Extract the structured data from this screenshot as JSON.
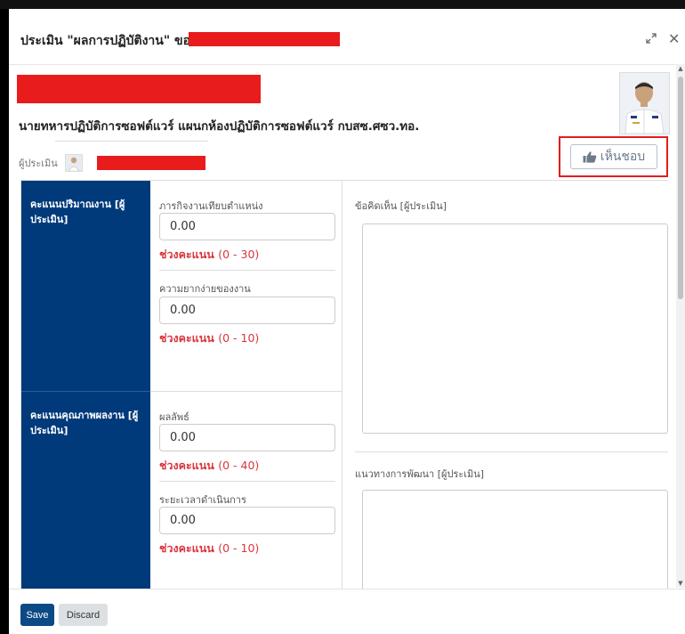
{
  "dialog": {
    "title_prefix": "ประเมิน \"ผลการปฏิบัติงาน\" ของ",
    "expand_icon": "expand-icon",
    "close_icon": "close-icon",
    "close_glyph": "✕"
  },
  "employee": {
    "position": "นายทหารปฏิบัติการซอฟต์แวร์ แผนกห้องปฏิบัติการซอฟต์แวร์ กบสซ.ศซว.ทอ.",
    "evaluator_label": "ผู้ประเมิน"
  },
  "like_button": {
    "label": "เห็นชอบ",
    "icon": "thumbs-up-icon"
  },
  "sections": [
    {
      "label": "คะแนนปริมาณงาน [ผู้ประเมิน]",
      "fields": [
        {
          "label": "ภารกิจงานเทียบตำแหน่ง",
          "value": "0.00",
          "range_label": "ช่วงคะแนน",
          "range": "(0 - 30)"
        },
        {
          "label": "ความยากง่ายของงาน",
          "value": "0.00",
          "range_label": "ช่วงคะแนน",
          "range": "(0 - 10)"
        }
      ]
    },
    {
      "label": "คะแนนคุณภาพผลงาน [ผู้ประเมิน]",
      "fields": [
        {
          "label": "ผลลัพธ์",
          "value": "0.00",
          "range_label": "ช่วงคะแนน",
          "range": "(0 - 40)"
        },
        {
          "label": "ระยะเวลาดำเนินการ",
          "value": "0.00",
          "range_label": "ช่วงคะแนน",
          "range": "(0 - 10)"
        }
      ]
    }
  ],
  "comments": {
    "label": "ข้อคิดเห็น [ผู้ประเมิน]",
    "value": ""
  },
  "development": {
    "label": "แนวทางการพัฒนา [ผู้ประเมิน]",
    "value": ""
  },
  "footer": {
    "save_label": "Save",
    "discard_label": "Discard"
  },
  "colors": {
    "primary": "#0c4a86",
    "section_bg": "#003a7a",
    "range_red": "#d9363e",
    "highlight_red": "#e21d1d",
    "redaction": "#e81c1c"
  }
}
